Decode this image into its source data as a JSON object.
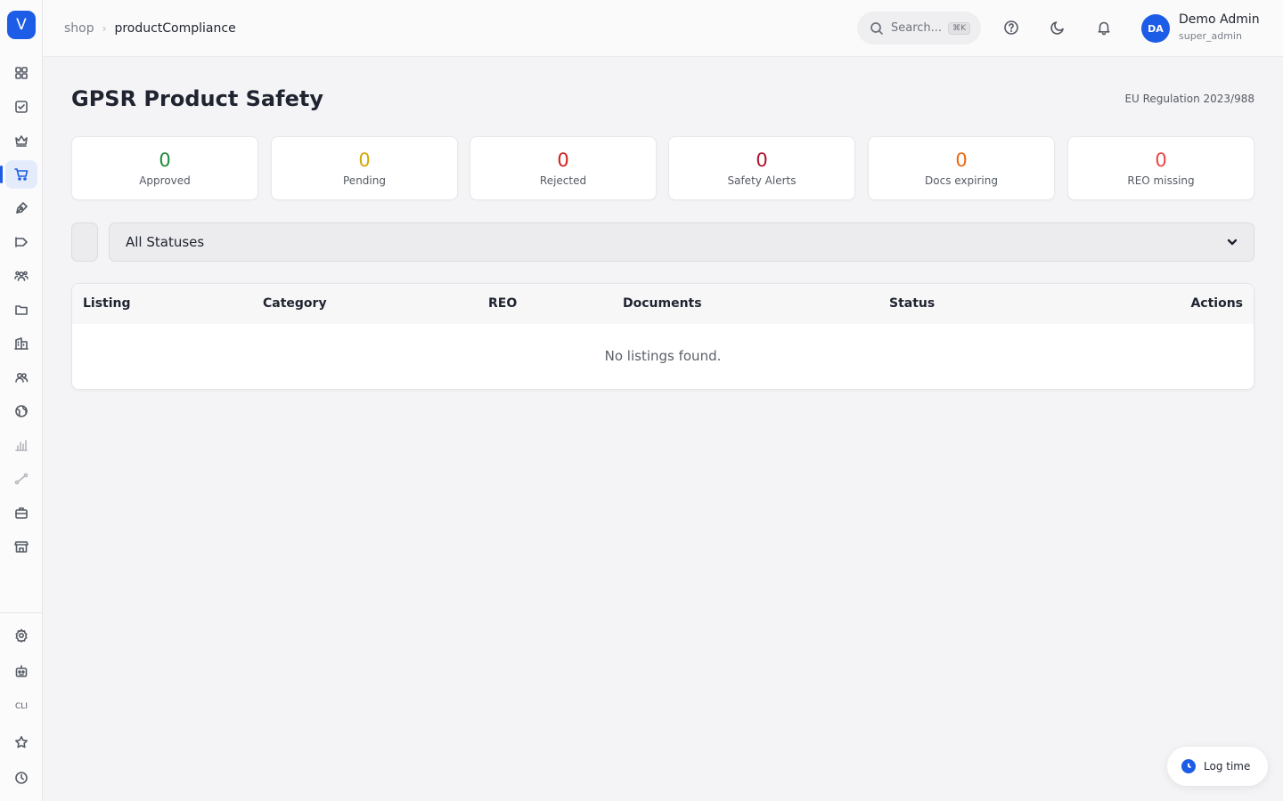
{
  "app": {
    "logo_letter": "V"
  },
  "breadcrumb": {
    "root": "shop",
    "separator": "›",
    "current": "productCompliance"
  },
  "topbar": {
    "search_placeholder": "Search...",
    "search_shortcut": "⌘K",
    "user": {
      "initials": "DA",
      "name": "Demo Admin",
      "role": "super_admin"
    }
  },
  "sidebar": {
    "items": [
      {
        "icon": "dashboard-grid-icon"
      },
      {
        "icon": "checkbox-icon"
      },
      {
        "icon": "crown-icon"
      },
      {
        "icon": "shopping-cart-icon",
        "active": true
      },
      {
        "icon": "pen-nib-icon"
      },
      {
        "icon": "megaphone-icon"
      },
      {
        "icon": "users-group-icon"
      },
      {
        "icon": "folder-icon"
      },
      {
        "icon": "building-icon"
      },
      {
        "icon": "users-icon"
      },
      {
        "icon": "globe-icon"
      },
      {
        "icon": "bar-chart-icon"
      },
      {
        "icon": "route-icon"
      },
      {
        "icon": "briefcase-icon"
      },
      {
        "icon": "store-icon"
      }
    ],
    "bottom_items": [
      {
        "icon": "gear-icon"
      },
      {
        "icon": "robot-icon"
      },
      {
        "icon": "cli-icon",
        "label": "CLI"
      },
      {
        "icon": "star-icon"
      },
      {
        "icon": "clock-icon"
      }
    ]
  },
  "page": {
    "title": "GPSR Product Safety",
    "regulation": "EU Regulation 2023/988"
  },
  "stats": [
    {
      "value": "0",
      "label": "Approved",
      "color": "#1f8a3a"
    },
    {
      "value": "0",
      "label": "Pending",
      "color": "#d4a70a"
    },
    {
      "value": "0",
      "label": "Rejected",
      "color": "#d11f1f"
    },
    {
      "value": "0",
      "label": "Safety Alerts",
      "color": "#b0112b"
    },
    {
      "value": "0",
      "label": "Docs expiring",
      "color": "#ec6a13"
    },
    {
      "value": "0",
      "label": "REO missing",
      "color": "#ef4444"
    }
  ],
  "filter": {
    "status_selected": "All Statuses"
  },
  "table": {
    "columns": [
      "Listing",
      "Category",
      "REO",
      "Documents",
      "Status",
      "Actions"
    ],
    "empty_message": "No listings found."
  },
  "log_time": {
    "label": "Log time"
  }
}
